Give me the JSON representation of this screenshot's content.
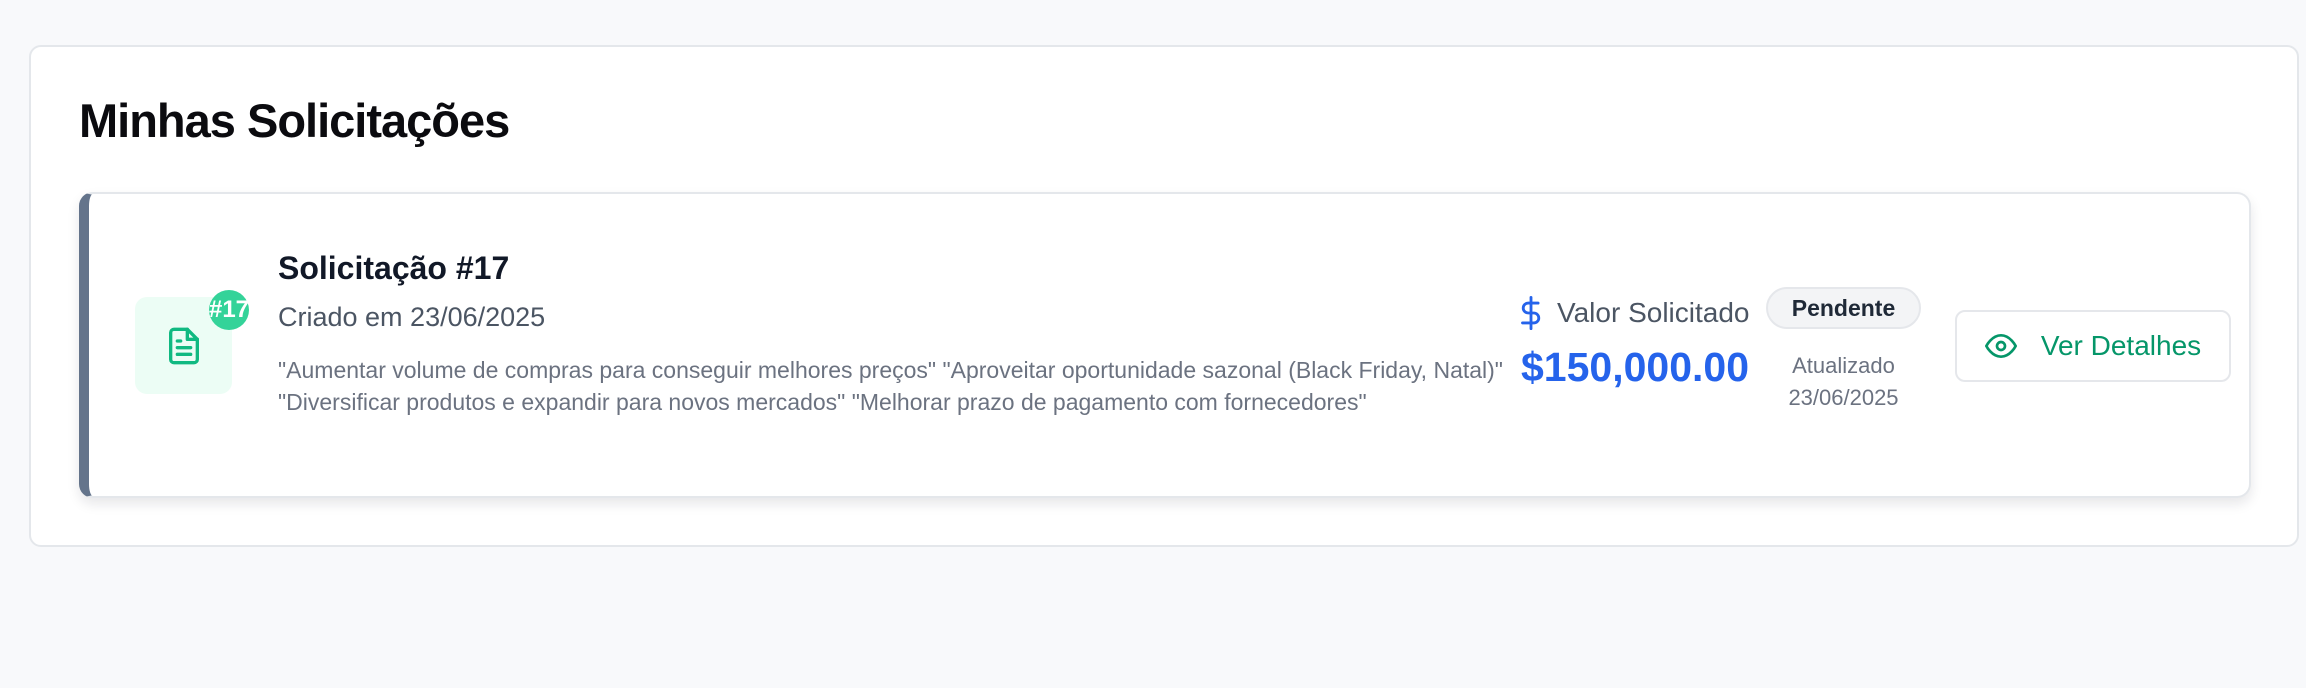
{
  "page": {
    "title": "Minhas Solicitações"
  },
  "request": {
    "badge": "#17",
    "title": "Solicitação #17",
    "created": "Criado em 23/06/2025",
    "description": "\"Aumentar volume de compras para conseguir melhores preços\" \"Aproveitar oportunidade sazonal (Black Friday, Natal)\" \"Diversificar produtos e expandir para novos mercados\" \"Melhorar prazo de pagamento com fornecedores\"",
    "value_label": "Valor Solicitado",
    "value_amount": "$150,000.00",
    "status": "Pendente",
    "updated_label": "Atualizado",
    "updated_date": "23/06/2025",
    "details_button": "Ver Detalhes"
  },
  "icons": {
    "document": "document-icon",
    "dollar": "dollar-icon",
    "eye": "eye-icon"
  },
  "colors": {
    "accent_green": "#059669",
    "badge_green": "#34d399",
    "amount_blue": "#2563eb",
    "card_border_left": "#64748b"
  }
}
